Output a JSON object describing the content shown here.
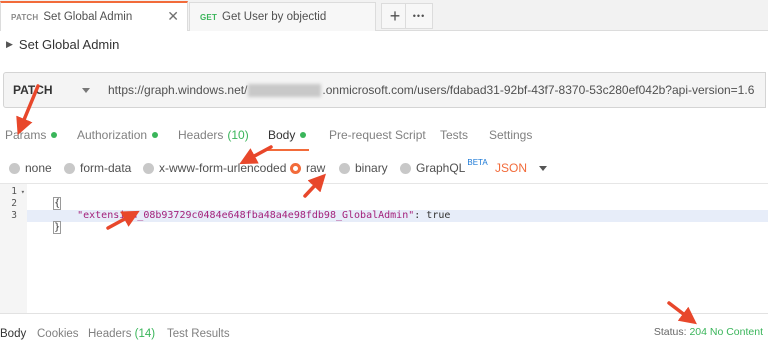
{
  "tabs": [
    {
      "method": "PATCH",
      "method_color": "#8a8a8a",
      "title": "Set Global Admin",
      "active": true
    },
    {
      "method": "GET",
      "method_color": "#3ab55a",
      "title": "Get User by objectid",
      "active": false
    }
  ],
  "tab_actions": {
    "add_label": "+",
    "more_label": "•••"
  },
  "request": {
    "title": "Set Global Admin",
    "method": "PATCH",
    "url_prefix": "https://graph.windows.net/",
    "url_suffix": ".onmicrosoft.com/users/fdabad31-92bf-43f7-8370-53c280ef042b?api-version=1.6"
  },
  "request_tabs": [
    {
      "label": "Params",
      "dot": true
    },
    {
      "label": "Authorization",
      "dot": true
    },
    {
      "label": "Headers",
      "count": "(10)"
    },
    {
      "label": "Body",
      "dot": true,
      "active": true
    },
    {
      "label": "Pre-request Script"
    },
    {
      "label": "Tests"
    },
    {
      "label": "Settings"
    }
  ],
  "body_types": [
    {
      "label": "none"
    },
    {
      "label": "form-data"
    },
    {
      "label": "x-www-form-urlencoded"
    },
    {
      "label": "raw",
      "selected": true
    },
    {
      "label": "binary"
    },
    {
      "label": "GraphQL",
      "badge": "BETA"
    }
  ],
  "body_format": "JSON",
  "editor": {
    "line_numbers": [
      "1",
      "2",
      "3"
    ],
    "open_brace": "{",
    "key": "\"extension_08b93729c0484e648fba48a4e98fdb98_GlobalAdmin\"",
    "separator": ": ",
    "value": "true",
    "close_brace": "}"
  },
  "response_tabs": [
    {
      "label": "Body",
      "active": true
    },
    {
      "label": "Cookies"
    },
    {
      "label": "Headers",
      "count": "(14)"
    },
    {
      "label": "Test Results"
    }
  ],
  "status": {
    "label": "Status:",
    "value": "204 No Content"
  },
  "colors": {
    "accent": "#f26b3a",
    "success": "#3ab55a",
    "annotation_arrow": "#e8472b",
    "json_key": "#a3217b",
    "beta": "#1a78d6"
  }
}
